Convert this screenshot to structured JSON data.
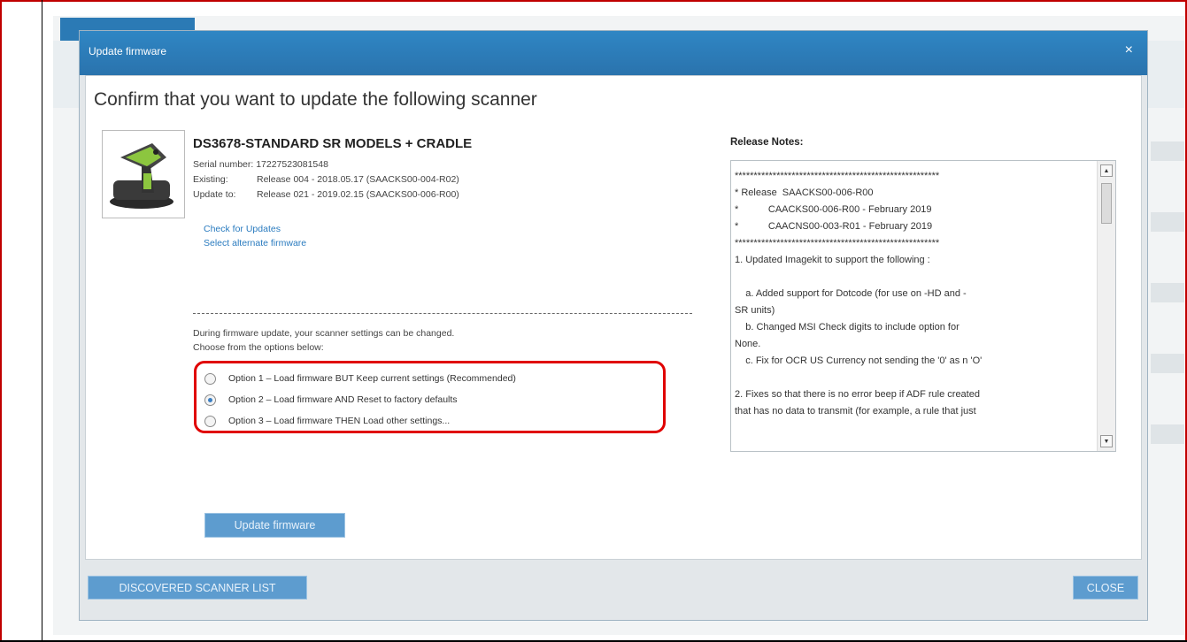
{
  "dialog": {
    "title": "Update firmware",
    "close_glyph": "×",
    "heading": "Confirm that you want to update the following scanner"
  },
  "scanner": {
    "name": "DS3678-STANDARD SR MODELS + CRADLE",
    "serial": "Serial number: 17227523081548",
    "existing_label": "Existing:",
    "existing_value": "Release 004 - 2018.05.17 (SAACKS00-004-R02)",
    "update_label": "Update to:",
    "update_value": "Release 021 - 2019.02.15 (SAACKS00-006-R00)"
  },
  "links": {
    "check_updates": "Check for Updates",
    "select_alternate": "Select alternate firmware"
  },
  "options": {
    "intro_line1": "During firmware update, your scanner settings can be changed.",
    "intro_line2": "Choose from the options below:",
    "items": [
      {
        "label": "Option 1 – Load firmware BUT Keep current settings (Recommended)",
        "selected": false
      },
      {
        "label": "Option 2 – Load firmware AND Reset to factory defaults",
        "selected": true
      },
      {
        "label": "Option 3 – Load firmware THEN Load other settings...",
        "selected": false
      }
    ]
  },
  "buttons": {
    "update_firmware": "Update firmware",
    "discovered_list": "DISCOVERED SCANNER LIST",
    "close": "CLOSE"
  },
  "release_notes": {
    "title": "Release Notes:",
    "text": "******************************************************\n* Release  SAACKS00-006-R00\n*           CAACKS00-006-R00 - February 2019\n*           CAACNS00-003-R01 - February 2019\n******************************************************\n1. Updated Imagekit to support the following :\n\n    a. Added support for Dotcode (for use on -HD and -\nSR units)\n    b. Changed MSI Check digits to include option for\nNone.\n    c. Fix for OCR US Currency not sending the '0' as n 'O'\n\n2. Fixes so that there is no error beep if ADF rule created\nthat has no data to transmit (for example, a rule that just",
    "scroll_up": "▲",
    "scroll_down": "▼"
  },
  "colors": {
    "title_bar": "#2f86c4",
    "highlight_outline": "#e00000",
    "button": "#5d9ccf",
    "link": "#2a7bbf"
  }
}
